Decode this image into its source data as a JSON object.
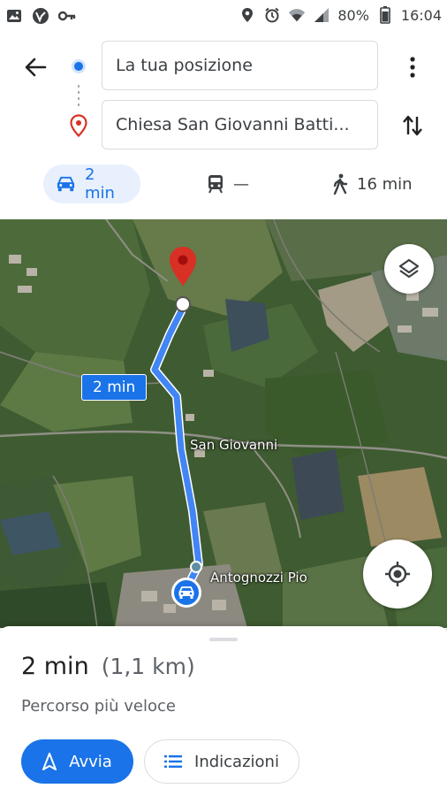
{
  "status_bar": {
    "battery": "80%",
    "time": "16:04"
  },
  "route": {
    "origin": "La tua posizione",
    "destination": "Chiesa San Giovanni Batti..."
  },
  "modes": [
    {
      "name": "car",
      "label": "2 min",
      "selected": true
    },
    {
      "name": "transit",
      "label": "—",
      "selected": false
    },
    {
      "name": "walk",
      "label": "16 min",
      "selected": false
    }
  ],
  "map": {
    "route_label": "2 min",
    "place_labels": [
      "San Giovanni",
      "Antognozzi Pio"
    ]
  },
  "sheet": {
    "duration": "2 min",
    "distance": "(1,1 km)",
    "subtitle": "Percorso più veloce",
    "start_label": "Avvia",
    "directions_label": "Indicazioni"
  },
  "colors": {
    "accent": "#1a73e8",
    "pin": "#d93025"
  }
}
